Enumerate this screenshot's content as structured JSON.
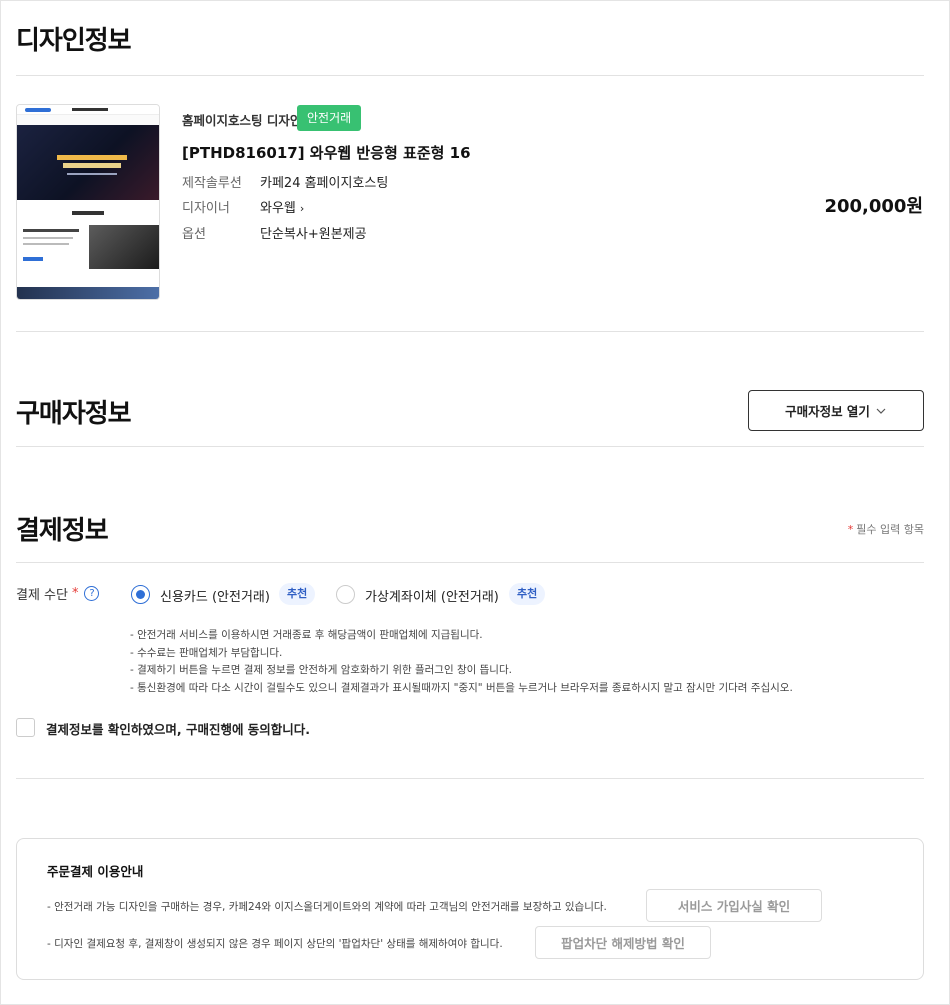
{
  "design_info": {
    "title": "디자인정보",
    "category": "홈페이지호스팅 디자인",
    "safe_badge": "안전거래",
    "product_name": "[PTHD816017] 와우웹 반응형 표준형 16",
    "rows": [
      {
        "label": "제작솔루션",
        "value": "카페24 홈페이지호스팅"
      },
      {
        "label": "디자이너",
        "value": "와우웹"
      },
      {
        "label": "옵션",
        "value": "단순복사+원본제공"
      }
    ],
    "price": "200,000원"
  },
  "buyer_info": {
    "title": "구매자정보",
    "open_button": "구매자정보 열기"
  },
  "payment_info": {
    "title": "결제정보",
    "required_note": "필수 입력 항목",
    "method_label": "결제 수단",
    "options": [
      {
        "label": "신용카드 (안전거래)",
        "badge": "추천",
        "selected": true
      },
      {
        "label": "가상계좌이체 (안전거래)",
        "badge": "추천",
        "selected": false
      }
    ],
    "notes": [
      "- 안전거래 서비스를 이용하시면 거래종료 후 해당금액이 판매업체에 지급됩니다.",
      "- 수수료는 판매업체가 부담합니다.",
      "- 결제하기 버튼을 누르면 결제 정보를 안전하게 암호화하기 위한 플러그인 창이 뜹니다.",
      "- 통신환경에 따라 다소 시간이 걸릴수도 있으니 결제결과가 표시될때까지 \"중지\" 버튼을 누르거나 브라우저를 종료하시지 말고 잠시만 기다려 주십시오."
    ],
    "agree_text": "결제정보를 확인하였으며, 구매진행에 동의합니다."
  },
  "guide": {
    "title": "주문결제 이용안내",
    "line1": "- 안전거래 가능 디자인을 구매하는 경우, 카페24와 이지스올더게이트와의 계약에 따라 고객님의 안전거래를 보장하고 있습니다.",
    "button1": "서비스 가입사실 확인",
    "line2": "- 디자인 결제요청 후, 결제창이 생성되지 않은 경우 페이지 상단의 '팝업차단' 상태를 해제하여야 합니다.",
    "button2": "팝업차단 해제방법 확인"
  },
  "colors": {
    "accent": "#2f6fd6",
    "safe_badge": "#38c172",
    "required_star": "#e53935"
  },
  "icons": [
    "help-icon",
    "chevron-right-icon",
    "chevron-down-icon",
    "radio-checked-icon",
    "checkbox-icon"
  ]
}
